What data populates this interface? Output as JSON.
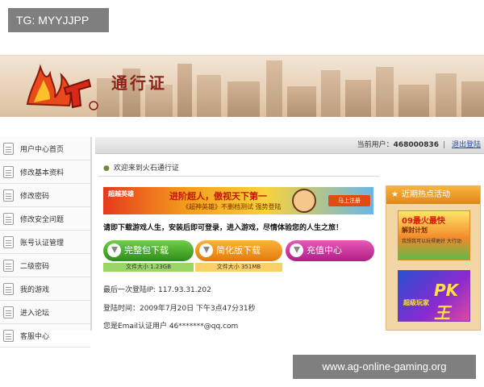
{
  "overlay": {
    "tag": "TG: MYYJJPP",
    "watermark": "www.ag-online-gaming.org"
  },
  "header": {
    "logo_alt": "火石",
    "title": "通行证"
  },
  "topbar": {
    "current_user_label": "当前用户：",
    "current_user_id": "468000836",
    "separator": "|",
    "logout": "退出登陆"
  },
  "sidebar": {
    "items": [
      {
        "label": "用户中心首页"
      },
      {
        "label": "修改基本资料"
      },
      {
        "label": "修改密码"
      },
      {
        "label": "修改安全问题"
      },
      {
        "label": "账号认证管理"
      },
      {
        "label": "二级密码"
      },
      {
        "label": "我的游戏"
      },
      {
        "label": "进入论坛"
      },
      {
        "label": "客服中心"
      }
    ]
  },
  "main": {
    "welcome": "欢迎来到火石通行证",
    "promo": {
      "left": "超越英雄",
      "main": "进阶超人，傲视天下第一",
      "sub": "《超神英雄》不删档测试 强势登陆",
      "cta": "马上注册"
    },
    "intro": "请即下载游戏人生，安装后即可登录，进入游戏，尽情体验您的人生之旅！",
    "buttons": {
      "full_download": "完整包下载",
      "lite_download": "简化版下载",
      "recharge": "充值中心"
    },
    "sizes": {
      "full": "文件大小 1.23GB",
      "lite": "文件大小 351MB"
    },
    "last_login_ip": "最后一次登陆IP: 117.93.31.202",
    "login_time": "登陆时间：2009年7月20日 下午3点47分31秒",
    "email": "您是Email认证用户  46*******@qq.com"
  },
  "right_panel": {
    "title": "近期热点活动",
    "ad1": {
      "line1": "09最火最快",
      "line2": "解封计划",
      "line3": "我想我可以玩得更好 大行动"
    },
    "ad2": {
      "line1": "超级玩家",
      "line2": "PK王"
    }
  },
  "colors": {
    "accent_orange": "#f7b43a",
    "download_green": "#2f8c1a",
    "download_orange": "#e07a0c",
    "recharge_pink": "#b01d84",
    "link_blue": "#2a4fa8"
  }
}
